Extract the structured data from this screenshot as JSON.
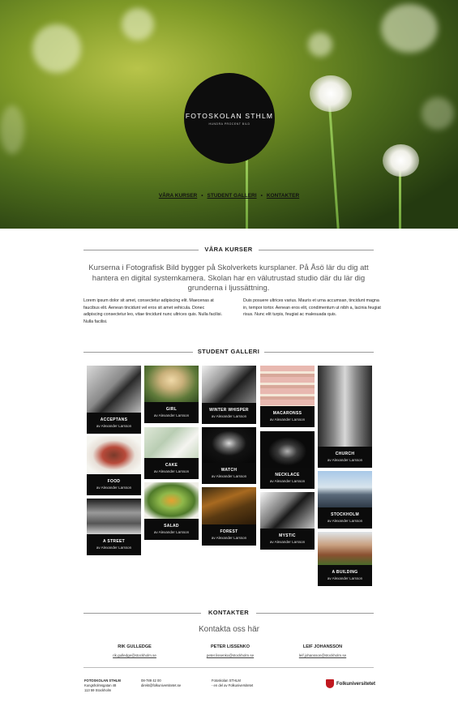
{
  "logo": {
    "title": "FOTOSKOLAN STHLM",
    "subtitle": "HUNDRA PROCENT BILD"
  },
  "nav": [
    {
      "label": "VÅRA KURSER"
    },
    {
      "label": "STUDENT GALLERI"
    },
    {
      "label": "KONTAKTER"
    }
  ],
  "courses": {
    "heading": "VÅRA KURSER",
    "lead": "Kurserna i Fotografisk Bild bygger på Skolverkets kursplaner. På Åsö lär du dig att hantera en digital systemkamera. Skolan har en välutrustad studio där du lär dig grunderna i ljussättning.",
    "col_left": "Lorem ipsum dolor sit amet, consectetur adipiscing elit. Maecenas at faucibus elit. Aenean tincidunt vel eros sit amet vehicula. Donec adipiscing consectetur leo, vitae tincidunt nunc ultrices quis. Nulla facilisi. Nulla facilisi.",
    "col_right": "Duis posuere ultrices varius. Mauris et urna accumsan, tincidunt magna in, tempor tortor. Aenean eros elit, condimentum ut nibh a, lacinia feugiat risus. Nunc elit turpis, feugiat ac malesuada quis."
  },
  "gallery": {
    "heading": "STUDENT GALLERI",
    "items": [
      {
        "name": "ACCEPTANS",
        "author": "av Alexander Larsson"
      },
      {
        "name": "FOOD",
        "author": "av Alexander Larsson"
      },
      {
        "name": "A STREET",
        "author": "av Alexander Larsson"
      },
      {
        "name": "GIRL",
        "author": "av Alexander Larsson"
      },
      {
        "name": "CAKE",
        "author": "av Alexander Larsson"
      },
      {
        "name": "SALAD",
        "author": "av Alexander Larsson"
      },
      {
        "name": "WINTER WHISPER",
        "author": "av Alexander Larsson"
      },
      {
        "name": "WATCH",
        "author": "av Alexander Larsson"
      },
      {
        "name": "FOREST",
        "author": "av Alexander Larsson"
      },
      {
        "name": "MACARONSS",
        "author": "av Alexander Larsson"
      },
      {
        "name": "NECKLACE",
        "author": "av Alexander Larsson"
      },
      {
        "name": "MYSTIC",
        "author": "av Alexander Larsson"
      },
      {
        "name": "CHURCH",
        "author": "av Alexander Larsson"
      },
      {
        "name": "STOCKHOLM",
        "author": "av Alexander Larsson"
      },
      {
        "name": "A BUILDING",
        "author": "av Alexander Larsson"
      }
    ]
  },
  "contact": {
    "heading": "KONTAKTER",
    "subheading": "Kontakta oss här",
    "people": [
      {
        "name": "RIK GULLEDGE",
        "email": "rik.gulledge@stockholm.se"
      },
      {
        "name": "PETER LISSENKO",
        "email": "peter.lissenko@stockholm.se"
      },
      {
        "name": "LEIF JOHANSSON",
        "email": "leif.johansson@stockholm.se"
      }
    ]
  },
  "footer": {
    "org_name": "FOTOSKOLAN STHLM",
    "street": "Kungsholmsgatan 48",
    "city": "113 59 Stockholm",
    "phone": "08-789 42 00",
    "email": "direkt@folkuniversitetet.se",
    "about_line1": "Fotoskolan STHLM",
    "about_line2": "- en del av Folkuniversitetet",
    "brand": "Folkuniversitetet",
    "brand_color": "#c0181f"
  }
}
